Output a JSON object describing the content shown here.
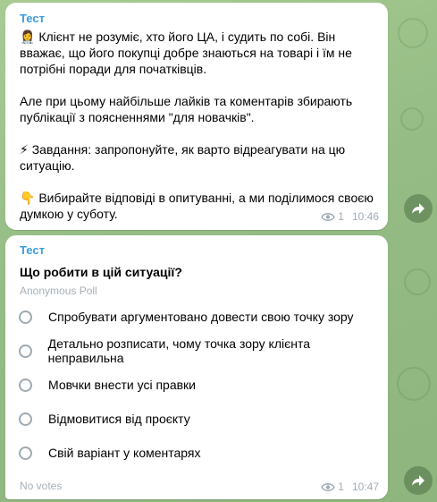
{
  "colors": {
    "sender": "#3a9be0",
    "wallpaper": "#9ac08a",
    "meta_text": "#a0acb6",
    "radio_border": "#9ea9b1"
  },
  "messages": [
    {
      "sender": "Тест",
      "paragraphs": [
        "👩‍⚕️ Клієнт не розуміє, хто його ЦА, і судить по собі. Він вважає, що його покупці добре знаються на товарі і їм не потрібні поради для початківців.",
        "Але при цьому найбільше лайків та коментарів збирають публікації з поясненнями \"для новачків\".",
        "⚡ Завдання: запропонуйте, як варто відреагувати на цю ситуацію.",
        "👇 Вибирайте відповіді в опитуванні, а ми поділимося своєю думкою у суботу."
      ],
      "views": "1",
      "time": "10:46"
    }
  ],
  "poll": {
    "sender": "Тест",
    "question": "Що робити в цій ситуації?",
    "type_label": "Anonymous Poll",
    "options": [
      "Спробувати аргументовано довести свою точку зору",
      "Детально розписати, чому точка зору клієнта неправильна",
      "Мовчки внести усі правки",
      "Відмовитися від проєкту",
      "Свій варіант у коментарях"
    ],
    "votes_label": "No votes",
    "views": "1",
    "time": "10:47"
  }
}
